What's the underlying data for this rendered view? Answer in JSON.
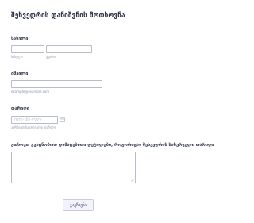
{
  "form": {
    "title": "შეხვედრის დანიშვნის მოთხოვნა"
  },
  "name_field": {
    "label": "სახელი",
    "first_sublabel": "სახელი",
    "last_sublabel": "გვარი",
    "first_value": "",
    "last_value": ""
  },
  "email_field": {
    "label": "იმეილი",
    "value": "",
    "sublabel": "example@example.com"
  },
  "date_field": {
    "label": "თარიღი",
    "placeholder": "mm-dd-yyyy",
    "sublabel": "აირჩიეთ სასურველი თარიღი",
    "icon": "calendar-icon"
  },
  "message_field": {
    "label": "გთხოვთ გვაცნობოთ დამატებითი დეტალები, როგორიცაა შეხვედრის სასურველი თარიღი",
    "value": ""
  },
  "submit": {
    "label": "გაგზავნა"
  },
  "colors": {
    "background": "#ffffff",
    "text": "#2c3345",
    "field_border": "#b8bdc9",
    "button_background": "#f3f3fe"
  }
}
